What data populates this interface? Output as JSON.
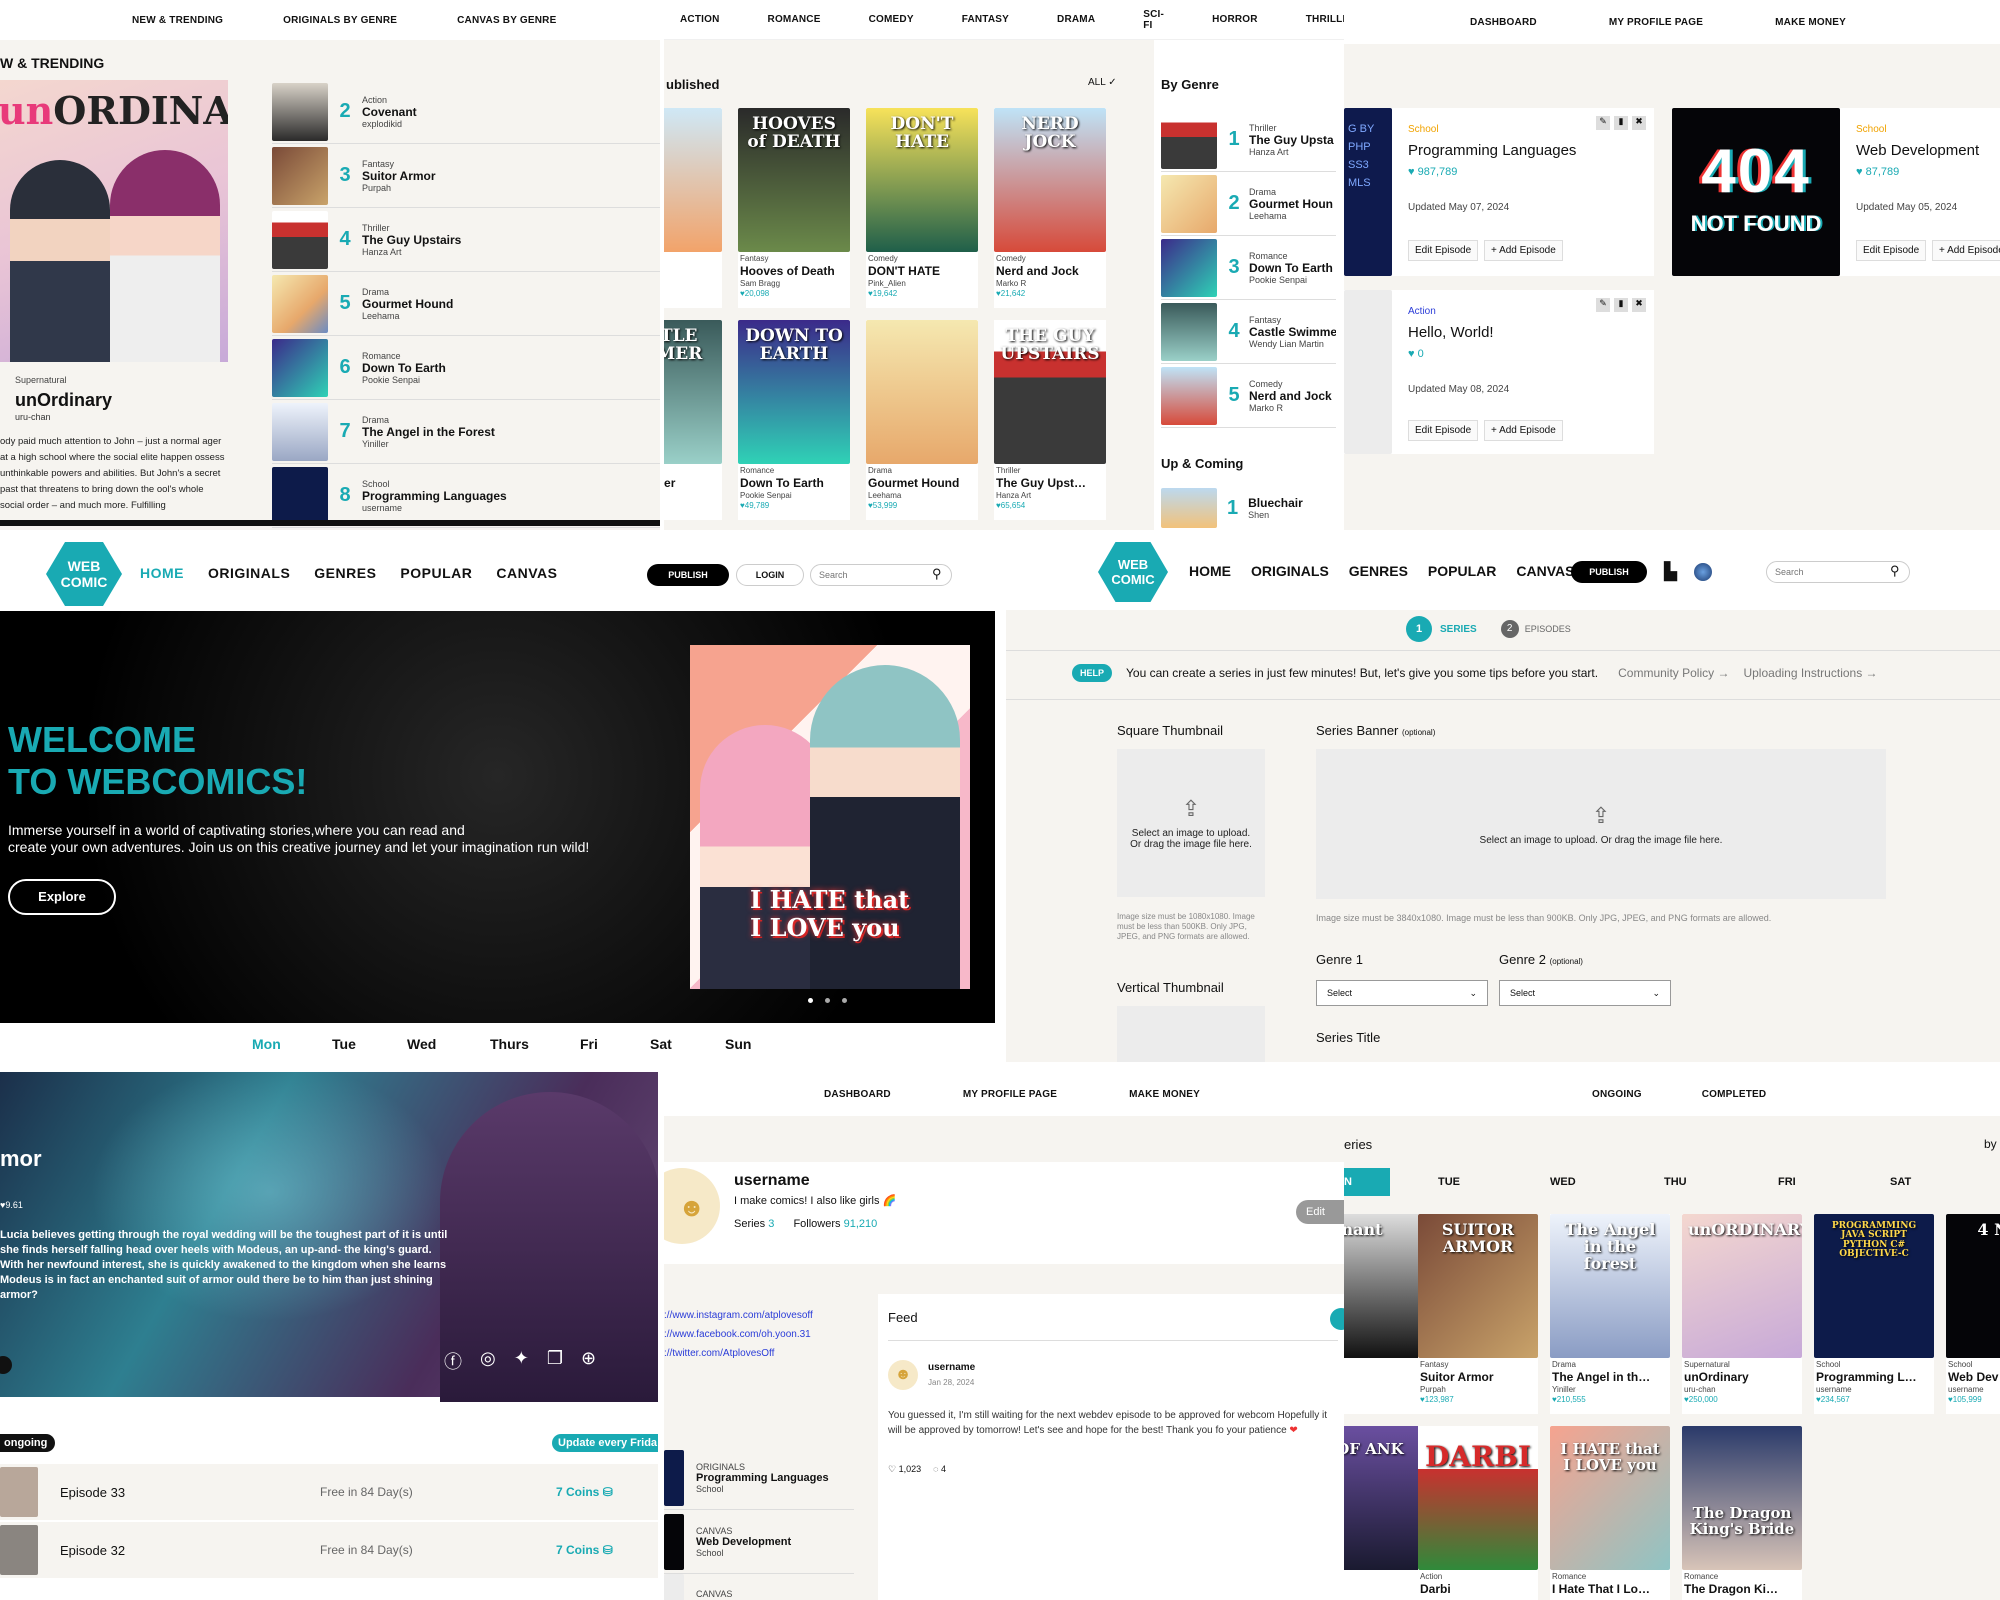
{
  "p1": {
    "nav": [
      "NEW & TRENDING",
      "ORIGINALS BY GENRE",
      "CANVAS BY GENRE"
    ],
    "heading": "W & TRENDING",
    "hero_title_a": "un",
    "hero_title_b": "ORDINARY",
    "genre": "Supernatural",
    "title": "unOrdinary",
    "author": "uru-chan",
    "desc": "ody paid much attention to John – just a normal ager at a high school where the social elite happen ossess unthinkable powers and abilities. But John's a secret past that threatens to bring down the ool's whole social order – and much more. Fulfilling",
    "list": [
      {
        "n": "2",
        "g": "Action",
        "t": "Covenant",
        "a": "explodikid"
      },
      {
        "n": "3",
        "g": "Fantasy",
        "t": "Suitor Armor",
        "a": "Purpah"
      },
      {
        "n": "4",
        "g": "Thriller",
        "t": "The Guy Upstairs",
        "a": "Hanza Art"
      },
      {
        "n": "5",
        "g": "Drama",
        "t": "Gourmet Hound",
        "a": "Leehama"
      },
      {
        "n": "6",
        "g": "Romance",
        "t": "Down To Earth",
        "a": "Pookie Senpai"
      },
      {
        "n": "7",
        "g": "Drama",
        "t": "The Angel in the Forest",
        "a": "Yiniller"
      },
      {
        "n": "8",
        "g": "School",
        "t": "Programming Languages",
        "a": "username"
      }
    ]
  },
  "p2": {
    "nav": [
      "ACTION",
      "ROMANCE",
      "COMEDY",
      "FANTASY",
      "DRAMA",
      "SCI-FI",
      "HORROR",
      "THRILLER"
    ],
    "heading": "ublished",
    "all": "ALL",
    "bygenre": "By Genre",
    "upcoming": "Up & Coming",
    "cards": [
      {
        "g": "",
        "t": "hair",
        "a": "",
        "c": ""
      },
      {
        "g": "Fantasy",
        "t": "Hooves of Death",
        "a": "Sam Bragg",
        "c": "20,098"
      },
      {
        "g": "Comedy",
        "t": "DON'T HATE",
        "a": "Pink_Alien",
        "c": "19,642"
      },
      {
        "g": "Comedy",
        "t": "Nerd and Jock",
        "a": "Marko R",
        "c": "21,642"
      },
      {
        "g": "",
        "t": "e Swimmer",
        "a": "ian Martin",
        "c": ""
      },
      {
        "g": "Romance",
        "t": "Down To Earth",
        "a": "Pookie Senpai",
        "c": "49,789"
      },
      {
        "g": "Drama",
        "t": "Gourmet Hound",
        "a": "Leehama",
        "c": "53,999"
      },
      {
        "g": "Thriller",
        "t": "The Guy Upst…",
        "a": "Hanza Art",
        "c": "65,654"
      }
    ],
    "thumbtext": [
      "",
      "HOOVES of DEATH",
      "DON'T HATE",
      "NERD JOCK",
      "ASTLE IMMER",
      "DOWN TO EARTH",
      "",
      "THE GUY UPSTAIRS"
    ],
    "side": [
      {
        "n": "1",
        "g": "Thriller",
        "t": "The Guy Upsta",
        "a": "Hanza Art"
      },
      {
        "n": "2",
        "g": "Drama",
        "t": "Gourmet Houn",
        "a": "Leehama"
      },
      {
        "n": "3",
        "g": "Romance",
        "t": "Down To Earth",
        "a": "Pookie Senpai"
      },
      {
        "n": "4",
        "g": "Fantasy",
        "t": "Castle Swimme",
        "a": "Wendy Lian Martin"
      },
      {
        "n": "5",
        "g": "Comedy",
        "t": "Nerd and Jock",
        "a": "Marko R"
      }
    ],
    "up": {
      "n": "1",
      "t": "Bluechair",
      "a": "Shen"
    }
  },
  "p3": {
    "nav": [
      "DASHBOARD",
      "MY PROFILE PAGE",
      "MAKE MONEY"
    ],
    "items": [
      {
        "g": "School",
        "t": "Programming Languages",
        "c": "987,789",
        "u": "Updated May 07, 2024"
      },
      {
        "g": "School",
        "t": "Web Development",
        "c": "87,789",
        "u": "Updated May 05, 2024"
      },
      {
        "g": "Action",
        "t": "Hello, World!",
        "c": "0",
        "u": "Updated May 08, 2024"
      }
    ],
    "edit": "Edit Episode",
    "add": "+ Add Episode",
    "img404a": "404",
    "img404b": "NOT FOUND",
    "sideimg": "G  BY  PHP SS3  MLS"
  },
  "p4": {
    "logo1": "WEB",
    "logo2": "COMIC",
    "nav": [
      "HOME",
      "ORIGINALS",
      "GENRES",
      "POPULAR",
      "CANVAS"
    ],
    "publish": "PUBLISH",
    "login": "LOGIN",
    "search_ph": "Search",
    "h1": "WELCOME",
    "h2": "TO WEBCOMICS!",
    "sub1": "Immerse yourself in a world of captivating stories,where you can read and",
    "sub2": "create your own adventures. Join us on this creative journey and let your imagination run wild!",
    "explore": "Explore",
    "cover1": "I HATE that",
    "cover2": "I LOVE you",
    "days": [
      "Mon",
      "Tue",
      "Wed",
      "Thurs",
      "Fri",
      "Sat",
      "Sun"
    ]
  },
  "p5": {
    "logo1": "WEB",
    "logo2": "COMIC",
    "nav": [
      "HOME",
      "ORIGINALS",
      "GENRES",
      "POPULAR",
      "CANVAS"
    ],
    "publish": "PUBLISH",
    "search_ph": "Search",
    "step1n": "1",
    "step1": "SERIES",
    "step2n": "2",
    "step2": "EPISODES",
    "help": "HELP",
    "help_text": "You can create a series in just few minutes! But, let's give you some tips before you start.",
    "link1": "Community Policy →",
    "link2": "Uploading Instructions →",
    "sq": "Square Thumbnail",
    "banner": "Series Banner",
    "optional": "(optional)",
    "upload1": "Select an image to upload.",
    "upload2": "Or drag the image file here.",
    "upload_banner": "Select an image to upload. Or drag the image file here.",
    "sq_note": "Image size must be 1080x1080. Image must be less than 500KB. Only JPG, JPEG, and PNG formats are allowed.",
    "banner_note": "Image size must be 3840x1080. Image must be less than 900KB. Only JPG, JPEG, and PNG formats are allowed.",
    "genre1": "Genre 1",
    "genre2": "Genre 2",
    "select": "Select",
    "vert": "Vertical Thumbnail",
    "series_title": "Series Title"
  },
  "p6": {
    "title": "mor",
    "rating": "9.61",
    "desc": "Lucia believes getting through the royal wedding will be the toughest part of it is until she finds herself falling head over heels with Modeus, an up-and- the king's guard. With her newfound interest, she is quickly awakened to the kingdom when she learns Modeus is in fact an enchanted suit of armor ould there be to him than just shining armor?",
    "status": "ongoing",
    "update": "Update every Frida",
    "episodes": [
      {
        "t": "Episode 33",
        "f": "Free in 84 Day(s)",
        "c": "7 Coins"
      },
      {
        "t": "Episode 32",
        "f": "Free in 84 Day(s)",
        "c": "7 Coins"
      }
    ]
  },
  "p7": {
    "nav": [
      "DASHBOARD",
      "MY PROFILE PAGE",
      "MAKE MONEY"
    ],
    "username": "username",
    "bio": "I make comics! I also like girls 🌈",
    "series_label": "Series",
    "series_n": "3",
    "followers_label": "Followers",
    "followers_n": "91,210",
    "edit": "Edit",
    "links": [
      "://www.instagram.com/atplovesoff",
      "://www.facebook.com/oh.yoon.31",
      "://twitter.com/AtplovesOff"
    ],
    "feed": "Feed",
    "post_user": "username",
    "post_date": "Jan 28, 2024",
    "post": "You guessed it, I'm still waiting for the next webdev episode to be approved for webcom Hopefully it will be approved by tomorrow! Let's see and hope for the best! Thank you fo your patience",
    "likes": "1,023",
    "comments": "4",
    "series": [
      {
        "type": "ORIGINALS",
        "t": "Programming Languages",
        "g": "School"
      },
      {
        "type": "CANVAS",
        "t": "Web Development",
        "g": "School"
      },
      {
        "type": "CANVAS",
        "t": "",
        "g": ""
      }
    ]
  },
  "p8": {
    "nav": [
      "ONGOING",
      "COMPLETED"
    ],
    "heading": "eries",
    "by": "by P",
    "days": [
      "N",
      "TUE",
      "WED",
      "THU",
      "FRI",
      "SAT"
    ],
    "cards": [
      {
        "g": "",
        "t": "t",
        "a": "",
        "c": ""
      },
      {
        "g": "Fantasy",
        "t": "Suitor Armor",
        "a": "Purpah",
        "c": "123,987"
      },
      {
        "g": "Drama",
        "t": "The Angel in th…",
        "a": "Yiniller",
        "c": "210,555"
      },
      {
        "g": "Supernatural",
        "t": "unOrdinary",
        "a": "uru-chan",
        "c": "250,000"
      },
      {
        "g": "School",
        "t": "Programming L…",
        "a": "username",
        "c": "234,567"
      },
      {
        "g": "School",
        "t": "Web Dev",
        "a": "username",
        "c": "105,999"
      }
    ],
    "thumbtext": [
      "nant",
      "SUITOR ARMOR",
      "The Angel in the forest",
      "unORDINARY",
      "PROGRAMMING JAVA SCRIPT PYTHON C# OBJECTIVE-C",
      "4 NOT"
    ],
    "row2": [
      {
        "g": "",
        "t": "lank",
        "th": "Y OF ANK"
      },
      {
        "g": "Action",
        "t": "Darbi",
        "th": "DARBI"
      },
      {
        "g": "Romance",
        "t": "I Hate That I Lo…",
        "th": "I HATE that I LOVE you"
      },
      {
        "g": "Romance",
        "t": "The Dragon Ki…",
        "th": "The Dragon King's Bride"
      }
    ]
  }
}
